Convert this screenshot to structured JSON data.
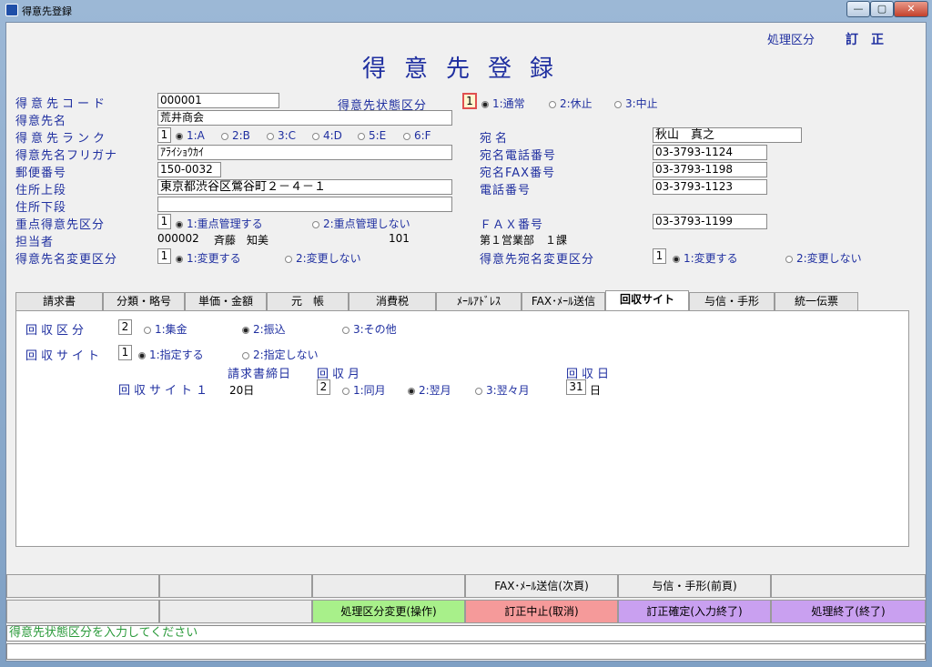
{
  "window": {
    "title": "得意先登録",
    "min": "—",
    "max": "▢",
    "close": "✕"
  },
  "mode": {
    "label": "処理区分",
    "value": "訂正"
  },
  "form_title": "得意先登録",
  "labels": {
    "code": "得意先コード",
    "name": "得意先名",
    "rank": "得意先ランク",
    "kana": "得意先名フリガナ",
    "zip": "郵便番号",
    "addr1": "住所上段",
    "addr2": "住所下段",
    "priority": "重点得意先区分",
    "rep": "担当者",
    "namechange": "得意先名変更区分",
    "state": "得意先状態区分",
    "dest": "宛名",
    "desttel": "宛名電話番号",
    "destfax": "宛名FAX番号",
    "tel": "電話番号",
    "fax": "ＦＡＸ番号",
    "destchange": "得意先宛名変更区分"
  },
  "values": {
    "code": "000001",
    "name": "荒井商会",
    "rank": "1",
    "kana": "ｱﾗｲｼｮｳｶｲ",
    "zip": "150-0032",
    "addr1": "東京都渋谷区鶯谷町２－４－１",
    "addr2": "",
    "priority": "1",
    "rep_code": "000002",
    "rep_name": "斉藤　知美",
    "rep_num": "101",
    "rep_dept": "第１営業部　１課",
    "namechange": "1",
    "state": "1",
    "dest": "秋山　真之",
    "desttel": "03-3793-1124",
    "destfax": "03-3793-1198",
    "tel": "03-3793-1123",
    "fax": "03-3793-1199",
    "destchange": "1"
  },
  "radios": {
    "state": [
      "1:通常",
      "2:休止",
      "3:中止"
    ],
    "rank": [
      "1:A",
      "2:B",
      "3:C",
      "4:D",
      "5:E",
      "6:F"
    ],
    "priority": [
      "1:重点管理する",
      "2:重点管理しない"
    ],
    "namechange": [
      "1:変更する",
      "2:変更しない"
    ],
    "destchange": [
      "1:変更する",
      "2:変更しない"
    ]
  },
  "tabs": [
    "請求書",
    "分類・略号",
    "単価・金額",
    "元　帳",
    "消費税",
    "ﾒｰﾙｱﾄﾞﾚｽ",
    "FAX･ﾒｰﾙ送信",
    "回収サイト",
    "与信・手形",
    "統一伝票"
  ],
  "panel": {
    "method_label": "回収区分",
    "method_value": "2",
    "method_options": [
      "1:集金",
      "2:振込",
      "3:その他"
    ],
    "site_label": "回収サイト",
    "site_value": "1",
    "site_options": [
      "1:指定する",
      "2:指定しない"
    ],
    "close_hdr": "請求書締日",
    "month_hdr": "回収月",
    "day_hdr": "回収日",
    "row_label": "回収サイト１",
    "row_close": "20日",
    "row_month": "2",
    "month_options": [
      "1:同月",
      "2:翌月",
      "3:翌々月"
    ],
    "row_day": "31",
    "day_unit": "日"
  },
  "fkeys_row1": [
    "",
    "",
    "",
    "FAX･ﾒｰﾙ送信(次頁)",
    "与信・手形(前頁)",
    ""
  ],
  "fkeys_row2": [
    "",
    "",
    "処理区分変更(操作)",
    "訂正中止(取消)",
    "訂正確定(入力終了)",
    "処理終了(終了)"
  ],
  "fkey_colors": [
    "#ececec",
    "#ececec",
    "#a8f08a",
    "#f59a9a",
    "#c9a0f0",
    "#c9a0f0"
  ],
  "status": "得意先状態区分を入力してください"
}
